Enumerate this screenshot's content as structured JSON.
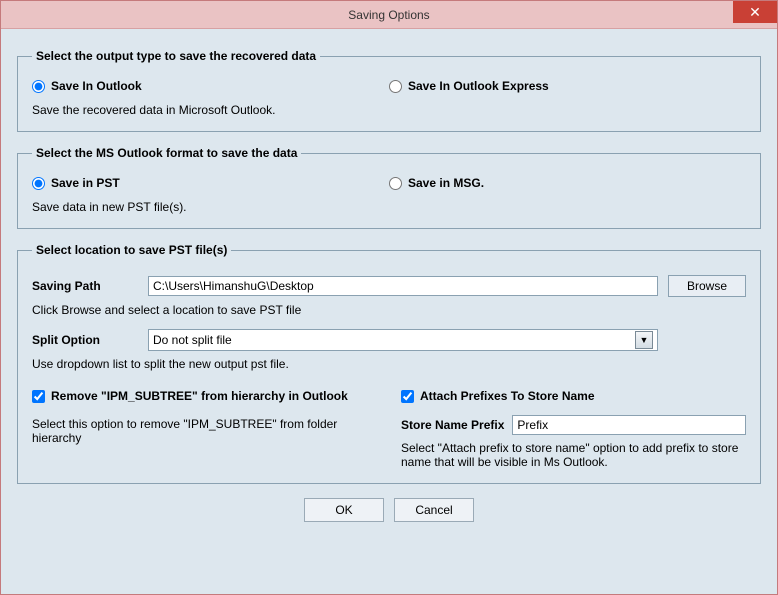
{
  "window": {
    "title": "Saving Options",
    "close_glyph": "✕"
  },
  "group1": {
    "legend": "Select the output type to save the recovered data",
    "opt1": "Save In Outlook",
    "opt2": "Save In Outlook Express",
    "desc": "Save the recovered data in Microsoft Outlook."
  },
  "group2": {
    "legend": "Select the MS Outlook format to save the data",
    "opt1": "Save in PST",
    "opt2": "Save in MSG.",
    "desc": "Save data in new PST file(s)."
  },
  "group3": {
    "legend": "Select location to save PST file(s)",
    "saving_path_label": "Saving Path",
    "saving_path_value": "C:\\Users\\HimanshuG\\Desktop",
    "browse_label": "Browse",
    "path_help": "Click Browse and select a location to save PST file",
    "split_label": "Split Option",
    "split_value": "Do not split file",
    "split_help": "Use dropdown list to split the new output pst file.",
    "remove_ipm_label": "Remove \"IPM_SUBTREE\" from hierarchy in Outlook",
    "remove_ipm_help": "Select this option to remove \"IPM_SUBTREE\" from folder hierarchy",
    "attach_prefix_label": "Attach Prefixes To Store Name",
    "prefix_label": "Store Name Prefix",
    "prefix_value": "Prefix",
    "prefix_help": "Select \"Attach prefix to store name\" option to add prefix to store name that will be visible in Ms Outlook."
  },
  "buttons": {
    "ok": "OK",
    "cancel": "Cancel"
  }
}
